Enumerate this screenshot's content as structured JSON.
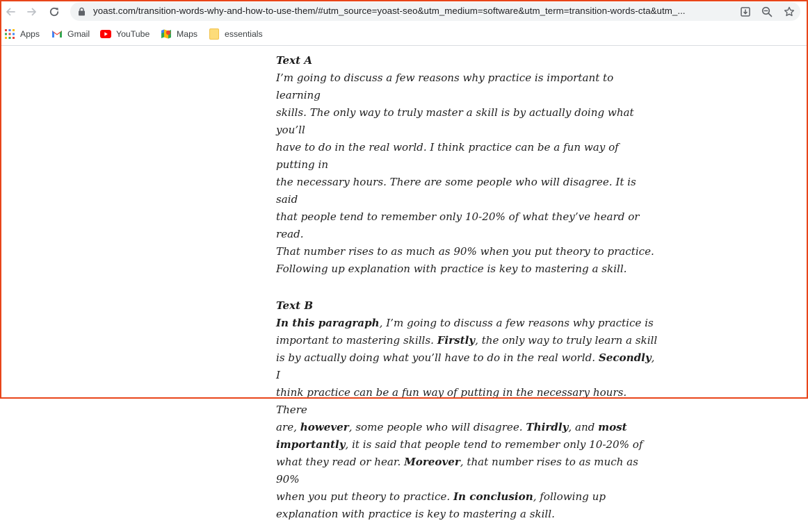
{
  "browser": {
    "url": "yoast.com/transition-words-why-and-how-to-use-them/#utm_source=yoast-seo&utm_medium=software&utm_term=transition-words-cta&utm_..."
  },
  "bookmarks": [
    {
      "label": "Apps",
      "icon": "apps-grid-icon"
    },
    {
      "label": "Gmail",
      "icon": "gmail-icon"
    },
    {
      "label": "YouTube",
      "icon": "youtube-icon"
    },
    {
      "label": "Maps",
      "icon": "maps-icon"
    },
    {
      "label": "essentials",
      "icon": "folder-icon"
    }
  ],
  "article": {
    "text_a": {
      "title": "Text A",
      "lines": [
        "I’m going to discuss a few reasons why practice is important to learning",
        "skills. The only way to truly master a skill is by actually doing what you’ll",
        "have to do in the real world. I think practice can be a fun way of putting in",
        "the necessary hours. There are some people who will disagree. It is said",
        "that people tend to remember only 10-20% of what they’ve heard or read.",
        "That number rises to as much as 90% when you put theory to practice.",
        "Following up explanation with practice is key to mastering a skill."
      ]
    },
    "text_b": {
      "title": "Text B",
      "lines": [
        [
          {
            "b": "In this paragraph"
          },
          {
            "t": ", I’m going to discuss a few reasons why practice is"
          }
        ],
        [
          {
            "t": "important to mastering skills. "
          },
          {
            "b": "Firstly"
          },
          {
            "t": ", the only way to truly learn a skill"
          }
        ],
        [
          {
            "t": "is by actually doing what you’ll have to do in the real world. "
          },
          {
            "b": "Secondly"
          },
          {
            "t": ", I"
          }
        ],
        [
          {
            "t": "think practice can be a fun way of putting in the necessary hours. There"
          }
        ],
        [
          {
            "t": "are, "
          },
          {
            "b": "however"
          },
          {
            "t": ", some people who will disagree. "
          },
          {
            "b": "Thirdly"
          },
          {
            "t": ", and "
          },
          {
            "b": "most"
          }
        ],
        [
          {
            "b": "importantly"
          },
          {
            "t": ", it is said that people tend to remember only 10-20% of"
          }
        ],
        [
          {
            "t": "what they read or hear. "
          },
          {
            "b": "Moreover"
          },
          {
            "t": ", that number rises to as much as 90%"
          }
        ],
        [
          {
            "t": "when you put theory to practice. "
          },
          {
            "b": "In conclusion"
          },
          {
            "t": ", following up"
          }
        ],
        [
          {
            "t": "explanation with practice is key to mastering a skill."
          }
        ]
      ]
    }
  },
  "colors": {
    "frame": "#e8461a",
    "omnibox": "#f1f3f4",
    "text": "#1e1e1e"
  }
}
